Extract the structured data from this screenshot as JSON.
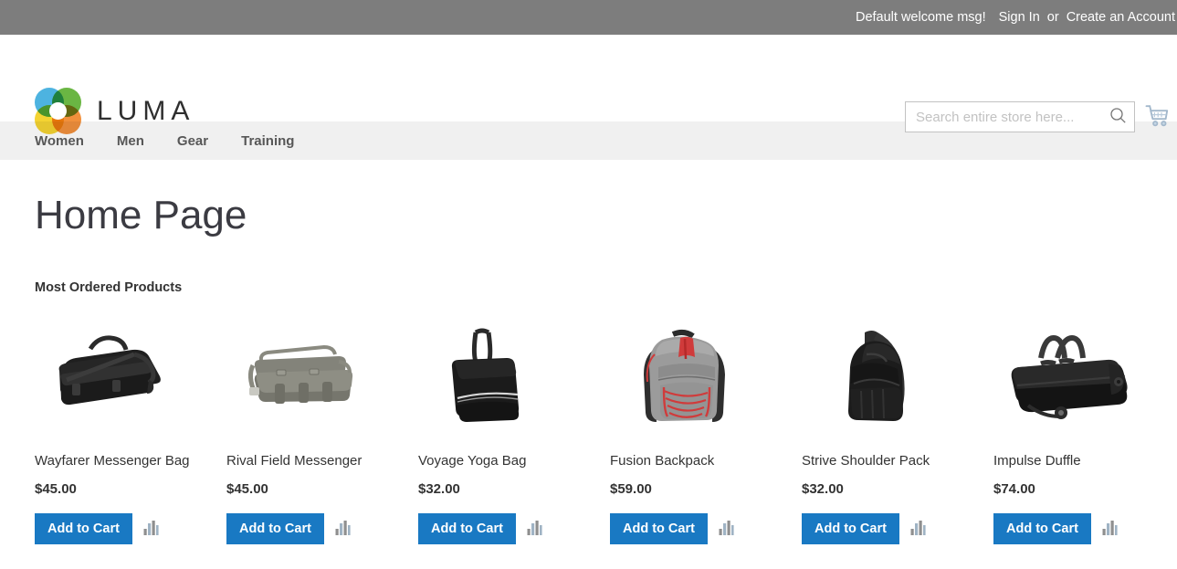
{
  "top_panel": {
    "welcome_message": "Default welcome msg!",
    "sign_in_label": "Sign In",
    "separator": "or",
    "create_account_label": "Create an Account"
  },
  "header": {
    "logo_text": "LUMA",
    "logo_icon": "luma-flower-logo",
    "search": {
      "placeholder": "Search entire store here...",
      "value": "",
      "icon": "search-icon"
    },
    "cart": {
      "icon": "shopping-cart-icon",
      "count": ""
    }
  },
  "nav": {
    "items": [
      {
        "label": "Women"
      },
      {
        "label": "Men"
      },
      {
        "label": "Gear"
      },
      {
        "label": "Training"
      }
    ]
  },
  "main": {
    "page_title": "Home Page",
    "block_title": "Most Ordered Products",
    "add_to_cart_label": "Add to Cart",
    "compare_icon": "compare-bar-chart-icon",
    "products": [
      {
        "name": "Wayfarer Messenger Bag",
        "price": "$45.00",
        "image": "black-messenger-bag"
      },
      {
        "name": "Rival Field Messenger",
        "price": "$45.00",
        "image": "gray-canvas-messenger-bag"
      },
      {
        "name": "Voyage Yoga Bag",
        "price": "$32.00",
        "image": "black-yoga-tote-bag"
      },
      {
        "name": "Fusion Backpack",
        "price": "$59.00",
        "image": "gray-red-backpack"
      },
      {
        "name": "Strive Shoulder Pack",
        "price": "$32.00",
        "image": "black-sling-shoulder-pack"
      },
      {
        "name": "Impulse Duffle",
        "price": "$74.00",
        "image": "black-rolling-duffle-bag"
      }
    ]
  },
  "colors": {
    "top_panel_bg": "#7d7d7d",
    "nav_bg": "#f0f0f0",
    "primary_button": "#1979c3",
    "text": "#333333",
    "placeholder": "#c2c2c2"
  }
}
